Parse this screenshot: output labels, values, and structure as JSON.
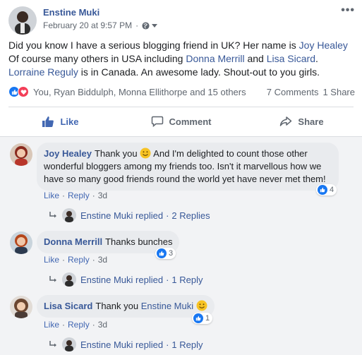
{
  "post": {
    "author": "Enstine Muki",
    "timestamp": "February 20 at 9:57 PM",
    "separator": "·",
    "more_icon": "more-dots-icon",
    "text": {
      "part1": "Did you know I have a serious blogging friend in UK? Her name is ",
      "link1": "Joy Healey",
      "part2": " Of course many others in USA including ",
      "link2": "Donna Merrill",
      "part3": " and ",
      "link3": "Lisa Sicard",
      "part4": ". ",
      "link4": "Lorraine Reguly",
      "part5": " is in Canada. An awesome lady. Shout-out to you girls."
    }
  },
  "reactions": {
    "names": "You, Ryan Biddulph, Monna Ellithorpe and 15 others",
    "comments_count": "7 Comments",
    "shares_count": "1 Share"
  },
  "actions": {
    "like": "Like",
    "comment": "Comment",
    "share": "Share"
  },
  "comments": [
    {
      "name": "Joy Healey",
      "text_before": "Thank you",
      "text_after": "And I'm delighted to count those other wonderful bloggers among my friends too. Isn't it marvellous how we have so many good friends round the world yet have never met them!",
      "like": "Like",
      "reply": "Reply",
      "time": "3d",
      "reactions": "4",
      "reply_author": "Enstine Muki replied",
      "reply_count": "2 Replies"
    },
    {
      "name": "Donna Merrill",
      "text": "Thanks bunches",
      "like": "Like",
      "reply": "Reply",
      "time": "3d",
      "reactions": "3",
      "reply_author": "Enstine Muki replied",
      "reply_count": "1 Reply"
    },
    {
      "name": "Lisa Sicard",
      "text_before": "Thank you",
      "text_link": "Enstine Muki",
      "like": "Like",
      "reply": "Reply",
      "time": "3d",
      "reactions": "1",
      "reply_author": "Enstine Muki replied",
      "reply_count": "1 Reply"
    }
  ],
  "colors": {
    "link": "#385898",
    "accent": "#1877f2",
    "love": "#f33e58"
  }
}
